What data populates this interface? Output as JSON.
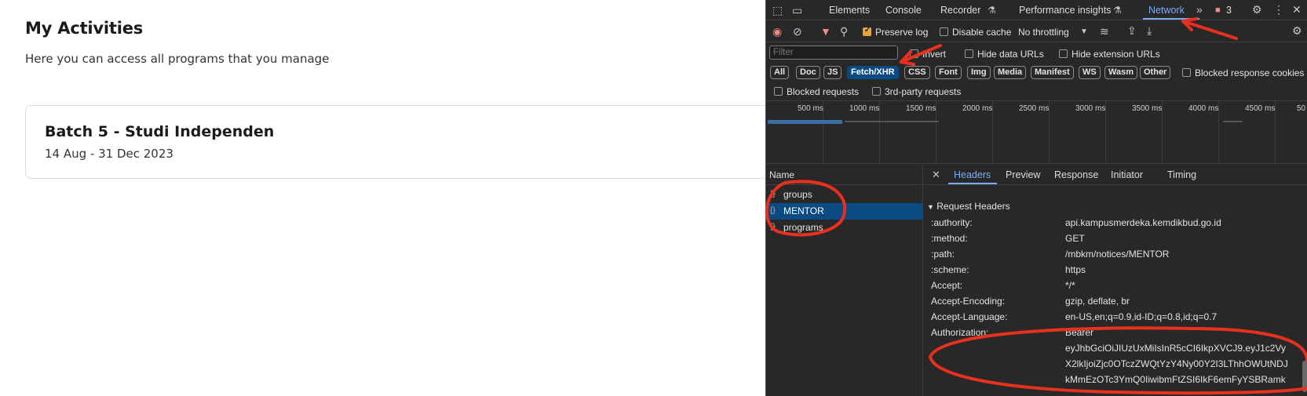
{
  "page": {
    "title": "My Activities",
    "subtitle": "Here you can access all programs that you manage",
    "card": {
      "title": "Batch 5 - Studi Independen",
      "dates": "14 Aug - 31 Dec 2023"
    }
  },
  "devtools": {
    "tabs": [
      "Elements",
      "Console",
      "Recorder",
      "Performance insights",
      "Network"
    ],
    "active_tab": "Network",
    "issues_count": "3",
    "toolbar": {
      "preserve_log": "Preserve log",
      "disable_cache": "Disable cache",
      "throttling": "No throttling"
    },
    "filter": {
      "placeholder": "Filter",
      "invert": "Invert",
      "hide_data_urls": "Hide data URLs",
      "hide_extension_urls": "Hide extension URLs"
    },
    "type_filters": [
      "All",
      "Doc",
      "JS",
      "Fetch/XHR",
      "CSS",
      "Font",
      "Img",
      "Media",
      "Manifest",
      "WS",
      "Wasm",
      "Other"
    ],
    "selected_type": "Fetch/XHR",
    "blocked_response_cookies": "Blocked response cookies",
    "blocked_requests": "Blocked requests",
    "third_party_requests": "3rd-party requests",
    "timeline_ticks": [
      "500 ms",
      "1000 ms",
      "1500 ms",
      "2000 ms",
      "2500 ms",
      "3000 ms",
      "3500 ms",
      "4000 ms",
      "4500 ms",
      "50"
    ],
    "name_header": "Name",
    "requests": [
      {
        "name": "groups",
        "selected": false
      },
      {
        "name": "MENTOR",
        "selected": true
      },
      {
        "name": "programs",
        "selected": false
      }
    ],
    "detail_tabs": [
      "Headers",
      "Preview",
      "Response",
      "Initiator",
      "Timing"
    ],
    "active_detail_tab": "Headers",
    "section_title": "Request Headers",
    "headers": [
      {
        "key": ":authority:",
        "value": "api.kampusmerdeka.kemdikbud.go.id"
      },
      {
        "key": ":method:",
        "value": "GET"
      },
      {
        "key": ":path:",
        "value": "/mbkm/notices/MENTOR"
      },
      {
        "key": ":scheme:",
        "value": "https"
      },
      {
        "key": "Accept:",
        "value": "*/*"
      },
      {
        "key": "Accept-Encoding:",
        "value": "gzip, deflate, br"
      },
      {
        "key": "Accept-Language:",
        "value": "en-US,en;q=0.9,id-ID;q=0.8,id;q=0.7"
      },
      {
        "key": "Authorization:",
        "value": "Bearer"
      }
    ],
    "auth_token_lines": [
      "eyJhbGciOiJIUzUxMiIsInR5cCI6IkpXVCJ9.eyJ1c2Vy",
      "X2lkIjoiZjc0OTczZWQtYzY4Ny00Y2I3LThhOWUtNDJ",
      "kMmEzOTc3YmQ0IiwibmFtZSI6IkF6emFyYSBRamk"
    ],
    "colors": {
      "bg": "#282828",
      "accent": "#7cacf8",
      "selected_row": "#0c4a83",
      "annotation": "#e8301f"
    }
  }
}
